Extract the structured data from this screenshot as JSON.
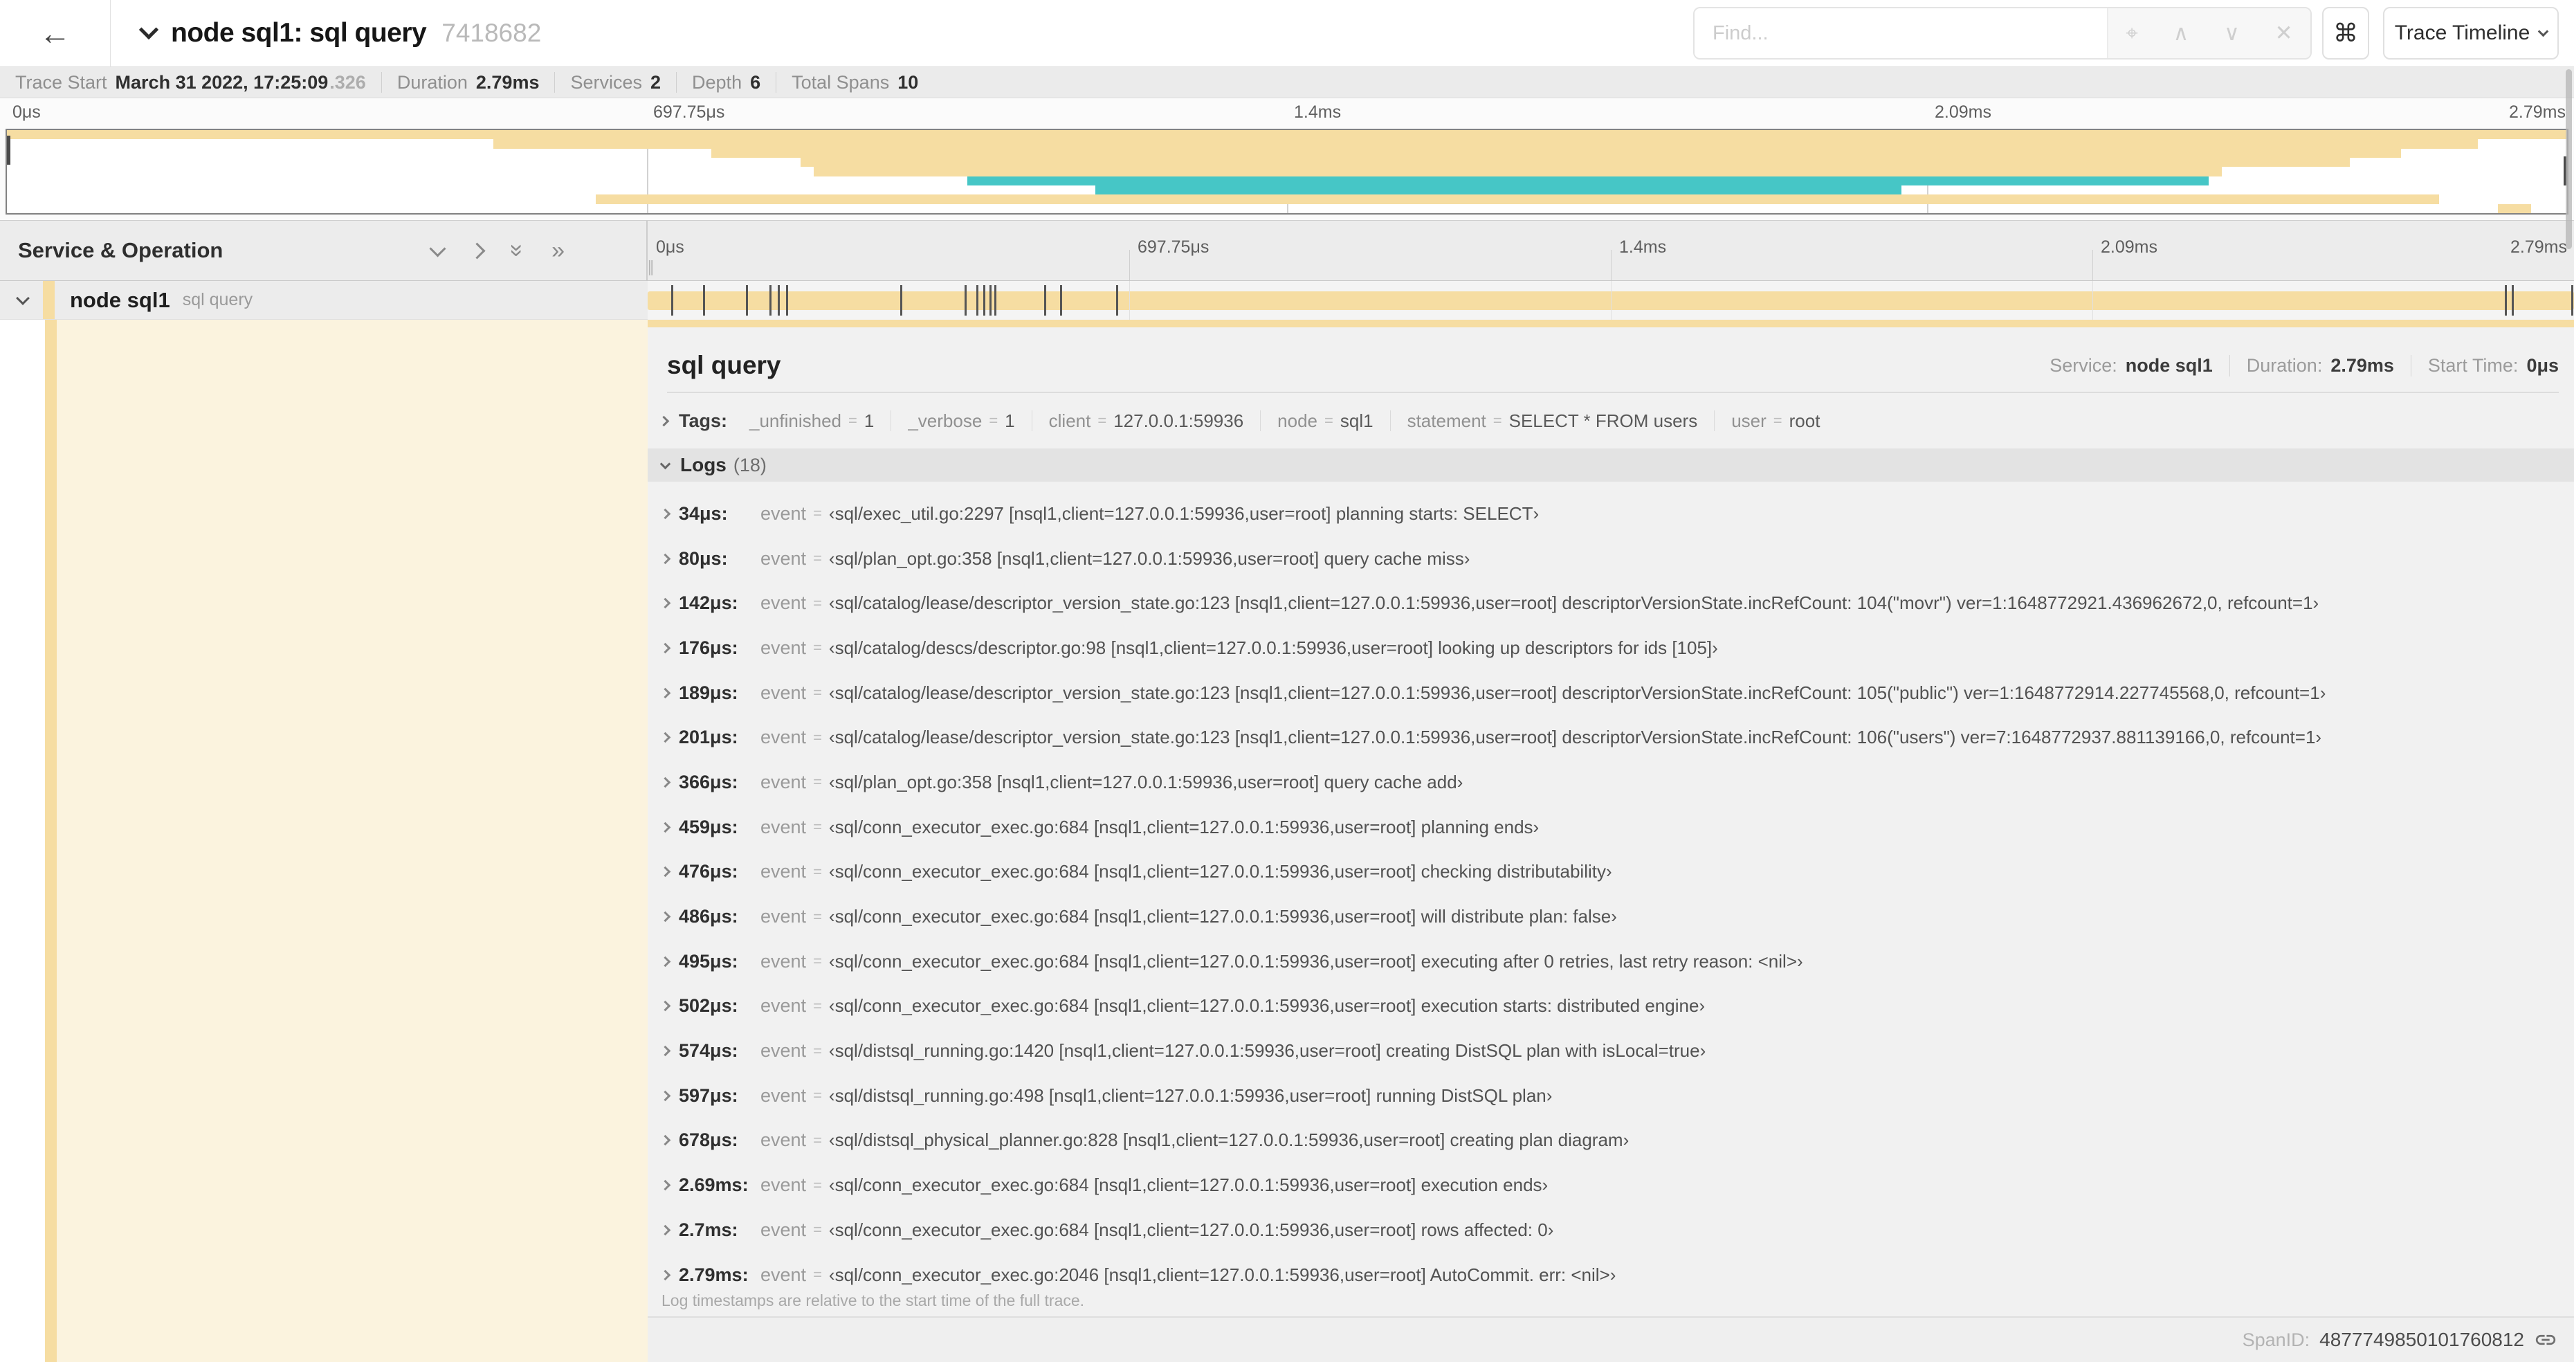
{
  "header": {
    "back_icon": "←",
    "title": "node sql1: sql query",
    "trace_id": "7418682",
    "find_placeholder": "Find...",
    "find_icons": [
      "⌖",
      "∧",
      "∨",
      "✕"
    ],
    "cmd_icon": "⌘",
    "trace_timeline_label": "Trace Timeline"
  },
  "trace_info": {
    "items": [
      {
        "label": "Trace Start",
        "value": "March 31 2022, 17:25:09",
        "value_suffix": ".326"
      },
      {
        "label": "Duration",
        "value": "2.79ms"
      },
      {
        "label": "Services",
        "value": "2"
      },
      {
        "label": "Depth",
        "value": "6"
      },
      {
        "label": "Total Spans",
        "value": "10"
      }
    ]
  },
  "colors": {
    "tan": "#f6dda2",
    "teal": "#46c6c6",
    "cream": "#fbf3de"
  },
  "minimap": {
    "tick_labels": [
      {
        "text": "0μs",
        "pos": 0
      },
      {
        "text": "697.75μs",
        "pos": 25
      },
      {
        "text": "1.4ms",
        "pos": 50
      },
      {
        "text": "2.09ms",
        "pos": 75
      },
      {
        "text": "2.79ms",
        "pos": 100
      }
    ],
    "spans": [
      {
        "color": "tan",
        "start": 0,
        "end": 100
      },
      {
        "color": "tan",
        "start": 19,
        "end": 96.5
      },
      {
        "color": "tan",
        "start": 27.5,
        "end": 93.5
      },
      {
        "color": "tan",
        "start": 31,
        "end": 91.5
      },
      {
        "color": "tan",
        "start": 31.5,
        "end": 86.5
      },
      {
        "color": "teal",
        "start": 37.5,
        "end": 86
      },
      {
        "color": "teal",
        "start": 42.5,
        "end": 74
      },
      {
        "color": "tan",
        "start": 23,
        "end": 95
      },
      {
        "color": "tan",
        "start": 97.3,
        "end": 98.6
      }
    ]
  },
  "timeline": {
    "left_header": "Service & Operation",
    "ruler_ticks": [
      {
        "text": "0μs",
        "pos": 0
      },
      {
        "text": "697.75μs",
        "pos": 25
      },
      {
        "text": "1.4ms",
        "pos": 50
      },
      {
        "text": "2.09ms",
        "pos": 75
      },
      {
        "text": "2.79ms",
        "pos": 100
      }
    ],
    "row": {
      "service": "node sql1",
      "operation": "sql query"
    },
    "log_marker_positions": [
      1.22,
      2.87,
      5.09,
      6.31,
      6.77,
      7.2,
      13.12,
      16.45,
      17.06,
      17.42,
      17.74,
      18.0,
      20.57,
      21.4,
      24.3,
      96.42,
      96.77,
      99.85
    ]
  },
  "detail": {
    "operation_title": "sql query",
    "meta": [
      {
        "label": "Service:",
        "value": "node sql1"
      },
      {
        "label": "Duration:",
        "value": "2.79ms"
      },
      {
        "label": "Start Time:",
        "value": "0μs"
      }
    ],
    "tags_label": "Tags:",
    "tags": [
      {
        "key": "_unfinished",
        "value": "1"
      },
      {
        "key": "_verbose",
        "value": "1"
      },
      {
        "key": "client",
        "value": "127.0.0.1:59936"
      },
      {
        "key": "node",
        "value": "sql1"
      },
      {
        "key": "statement",
        "value": "SELECT * FROM users"
      },
      {
        "key": "user",
        "value": "root"
      }
    ],
    "logs_label": "Logs",
    "logs_count": "(18)",
    "log_field_key": "event",
    "logs": [
      {
        "time": "34μs:",
        "event": "‹sql/exec_util.go:2297 [nsql1,client=127.0.0.1:59936,user=root] planning starts: SELECT›"
      },
      {
        "time": "80μs:",
        "event": "‹sql/plan_opt.go:358 [nsql1,client=127.0.0.1:59936,user=root] query cache miss›"
      },
      {
        "time": "142μs:",
        "event": "‹sql/catalog/lease/descriptor_version_state.go:123 [nsql1,client=127.0.0.1:59936,user=root] descriptorVersionState.incRefCount: 104(\"movr\") ver=1:1648772921.436962672,0, refcount=1›"
      },
      {
        "time": "176μs:",
        "event": "‹sql/catalog/descs/descriptor.go:98 [nsql1,client=127.0.0.1:59936,user=root] looking up descriptors for ids [105]›"
      },
      {
        "time": "189μs:",
        "event": "‹sql/catalog/lease/descriptor_version_state.go:123 [nsql1,client=127.0.0.1:59936,user=root] descriptorVersionState.incRefCount: 105(\"public\") ver=1:1648772914.227745568,0, refcount=1›"
      },
      {
        "time": "201μs:",
        "event": "‹sql/catalog/lease/descriptor_version_state.go:123 [nsql1,client=127.0.0.1:59936,user=root] descriptorVersionState.incRefCount: 106(\"users\") ver=7:1648772937.881139166,0, refcount=1›"
      },
      {
        "time": "366μs:",
        "event": "‹sql/plan_opt.go:358 [nsql1,client=127.0.0.1:59936,user=root] query cache add›"
      },
      {
        "time": "459μs:",
        "event": "‹sql/conn_executor_exec.go:684 [nsql1,client=127.0.0.1:59936,user=root] planning ends›"
      },
      {
        "time": "476μs:",
        "event": "‹sql/conn_executor_exec.go:684 [nsql1,client=127.0.0.1:59936,user=root] checking distributability›"
      },
      {
        "time": "486μs:",
        "event": "‹sql/conn_executor_exec.go:684 [nsql1,client=127.0.0.1:59936,user=root] will distribute plan: false›"
      },
      {
        "time": "495μs:",
        "event": "‹sql/conn_executor_exec.go:684 [nsql1,client=127.0.0.1:59936,user=root] executing after 0 retries, last retry reason: <nil>›"
      },
      {
        "time": "502μs:",
        "event": "‹sql/conn_executor_exec.go:684 [nsql1,client=127.0.0.1:59936,user=root] execution starts: distributed engine›"
      },
      {
        "time": "574μs:",
        "event": "‹sql/distsql_running.go:1420 [nsql1,client=127.0.0.1:59936,user=root] creating DistSQL plan with isLocal=true›"
      },
      {
        "time": "597μs:",
        "event": "‹sql/distsql_running.go:498 [nsql1,client=127.0.0.1:59936,user=root] running DistSQL plan›"
      },
      {
        "time": "678μs:",
        "event": "‹sql/distsql_physical_planner.go:828 [nsql1,client=127.0.0.1:59936,user=root] creating plan diagram›"
      },
      {
        "time": "2.69ms:",
        "event": "‹sql/conn_executor_exec.go:684 [nsql1,client=127.0.0.1:59936,user=root] execution ends›"
      },
      {
        "time": "2.7ms:",
        "event": "‹sql/conn_executor_exec.go:684 [nsql1,client=127.0.0.1:59936,user=root] rows affected: 0›"
      },
      {
        "time": "2.79ms:",
        "event": "‹sql/conn_executor_exec.go:2046 [nsql1,client=127.0.0.1:59936,user=root] AutoCommit. err: <nil>›"
      }
    ],
    "footer_note": "Log timestamps are relative to the start time of the full trace.",
    "span_id_label": "SpanID:",
    "span_id": "4877749850101760812"
  }
}
